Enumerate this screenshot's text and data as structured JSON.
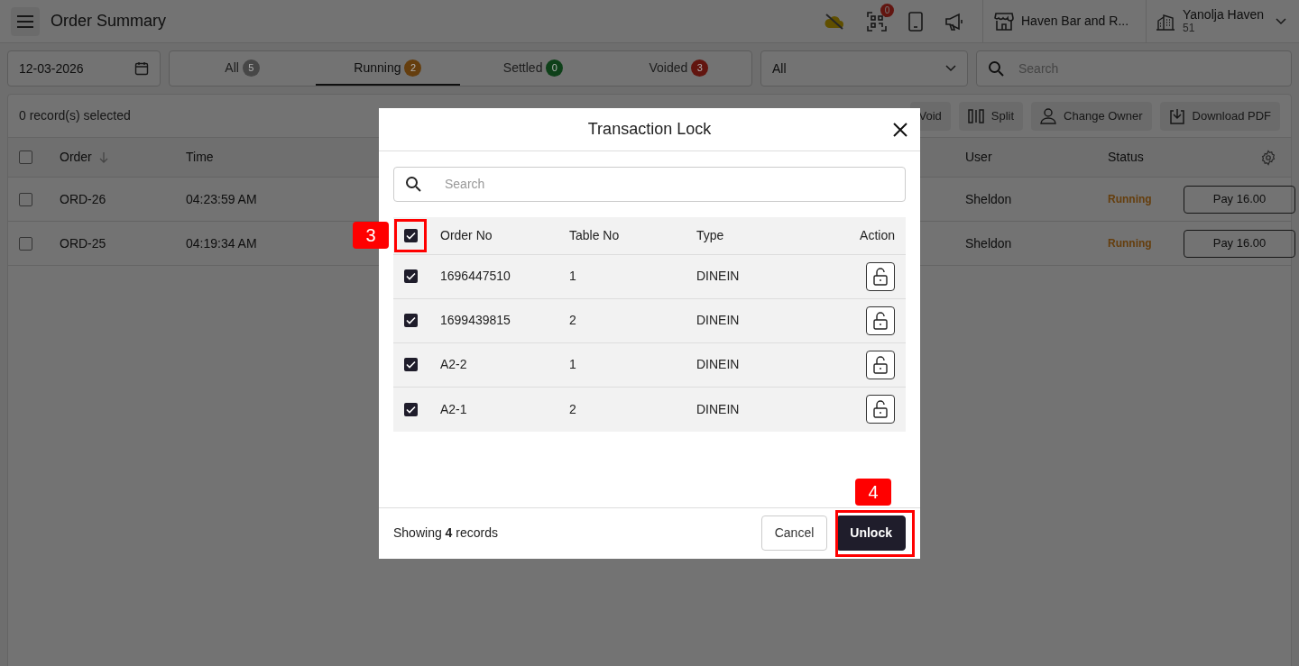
{
  "header": {
    "title": "Order Summary",
    "notification_count": "0",
    "store": "Haven Bar and R...",
    "user_name": "Yanolja Haven",
    "user_sub": "51"
  },
  "filters": {
    "date": "12-03-2026",
    "tabs": [
      {
        "label": "All",
        "count": "5",
        "color": "#474747",
        "selected": false
      },
      {
        "label": "Running",
        "count": "2",
        "color": "#653e0e",
        "selected": true
      },
      {
        "label": "Settled",
        "count": "0",
        "color": "#0e4019",
        "selected": false
      },
      {
        "label": "Voided",
        "count": "3",
        "color": "#62150f",
        "selected": false
      }
    ],
    "type_select": "All",
    "search_placeholder": "Search"
  },
  "toolbar": {
    "selection_text": "0 record(s) selected",
    "actions": [
      {
        "label": "Void",
        "kind": "void"
      },
      {
        "label": "Split",
        "kind": "split"
      },
      {
        "label": "Change Owner",
        "kind": "owner"
      },
      {
        "label": "Download PDF",
        "kind": "download"
      }
    ]
  },
  "orders_table": {
    "all_checked": false,
    "columns": [
      "Order",
      "Time",
      "User",
      "Status"
    ],
    "rows": [
      {
        "checked": false,
        "order": "ORD-26",
        "time": "04:23:59 AM",
        "user": "Sheldon",
        "status": "Running",
        "action": "Pay 16.00"
      },
      {
        "checked": false,
        "order": "ORD-25",
        "time": "04:19:34 AM",
        "user": "Sheldon",
        "status": "Running",
        "action": "Pay 16.00"
      }
    ]
  },
  "dialog": {
    "title": "Transaction Lock",
    "search_placeholder": "Search",
    "all_checked": true,
    "columns": [
      "Order No",
      "Table No",
      "Type",
      "Action"
    ],
    "rows": [
      {
        "checked": true,
        "order_no": "1696447510",
        "table_no": "1",
        "type": "DINEIN"
      },
      {
        "checked": true,
        "order_no": "1699439815",
        "table_no": "2",
        "type": "DINEIN"
      },
      {
        "checked": true,
        "order_no": "A2-2",
        "table_no": "1",
        "type": "DINEIN"
      },
      {
        "checked": true,
        "order_no": "A2-1",
        "table_no": "2",
        "type": "DINEIN"
      }
    ],
    "footer_text": "Showing **4** records",
    "buttons": [
      {
        "label": "Cancel",
        "kind": "secondary"
      },
      {
        "label": "Unlock",
        "kind": "primary"
      }
    ]
  },
  "annotations": [
    {
      "label": "3"
    },
    {
      "label": "4"
    }
  ]
}
